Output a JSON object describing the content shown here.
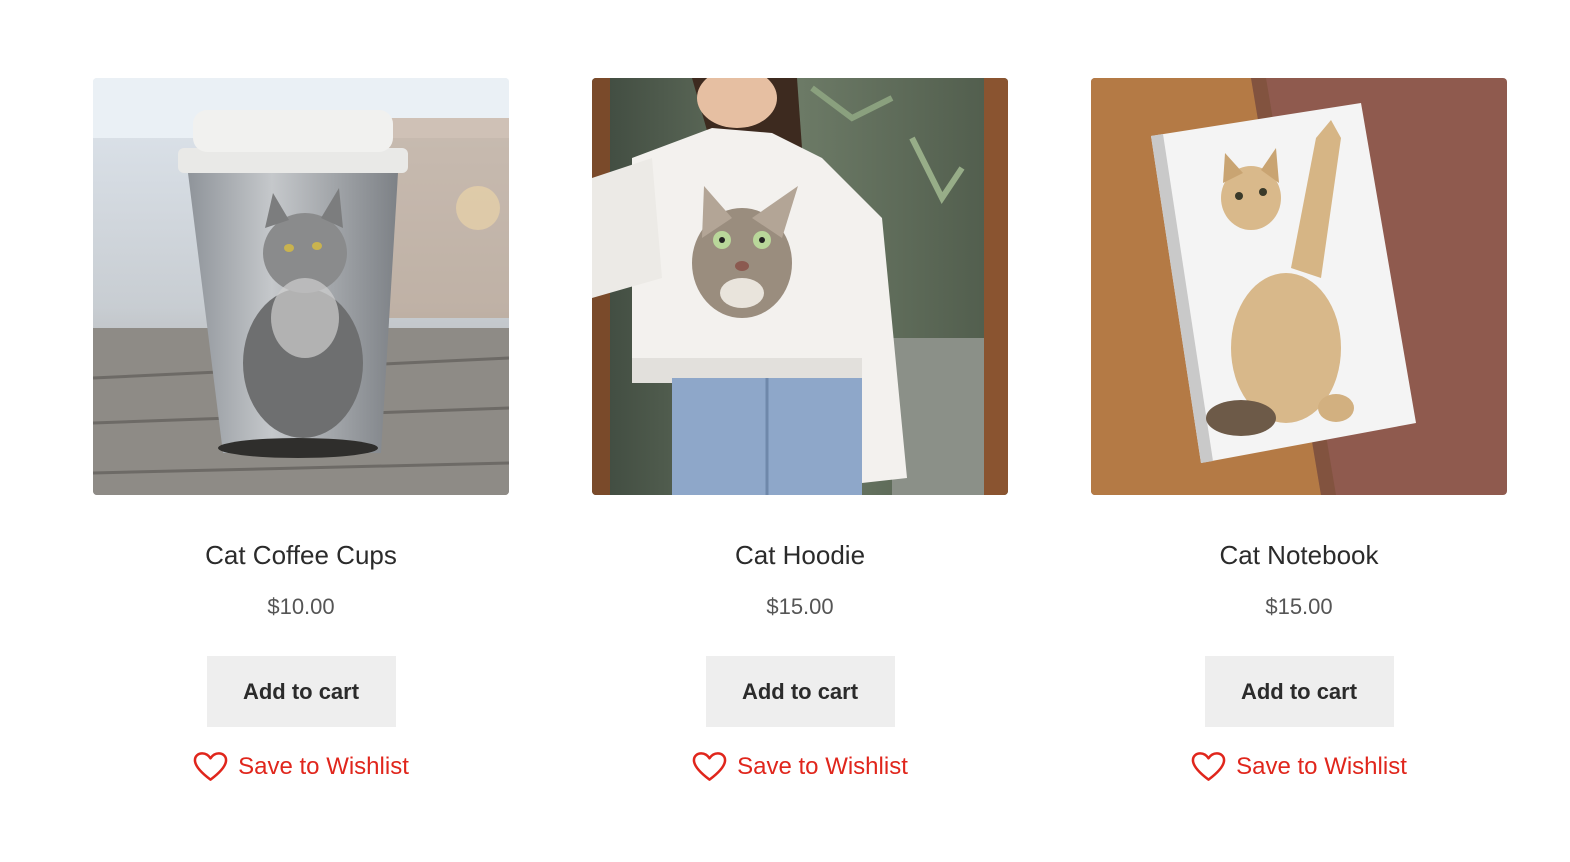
{
  "products": [
    {
      "title": "Cat Coffee Cups",
      "price": "$10.00",
      "add_to_cart_label": "Add to cart",
      "wishlist_label": "Save to Wishlist",
      "image": "coffee-cup-with-cat-print"
    },
    {
      "title": "Cat Hoodie",
      "price": "$15.00",
      "add_to_cart_label": "Add to cart",
      "wishlist_label": "Save to Wishlist",
      "image": "white-hoodie-with-cat-face"
    },
    {
      "title": "Cat Notebook",
      "price": "$15.00",
      "add_to_cart_label": "Add to cart",
      "wishlist_label": "Save to Wishlist",
      "image": "notebook-with-kitten-print"
    }
  ],
  "colors": {
    "wishlist_accent": "#e0261c",
    "button_bg": "#eeeeee",
    "title_text": "#2b2b2b",
    "price_text": "#555555"
  },
  "icons": {
    "wishlist": "heart-outline-icon"
  }
}
